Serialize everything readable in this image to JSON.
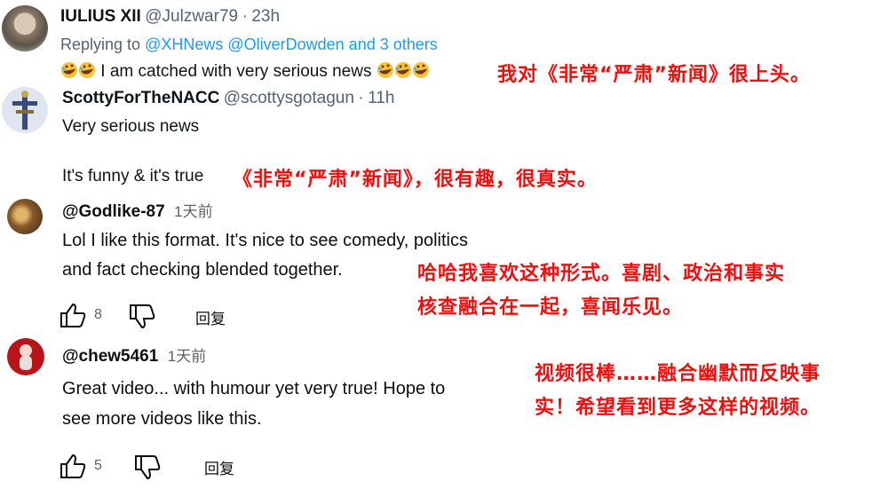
{
  "tweet1": {
    "name": "IULIUS XII",
    "handle": "@Julzwar79",
    "dot": "·",
    "time": "23h",
    "replying_prefix": "Replying to",
    "replying_mentions": "@XHNews @OliverDowden and 3 others",
    "text": "I am catched with very serious news",
    "emoji_icon": "rolling-on-floor-laughing-emoji",
    "translation": "我对《非常“严肃”新闻》很上头。"
  },
  "tweet2": {
    "name": "ScottyForTheNACC",
    "handle": "@scottysgotagun",
    "dot": "·",
    "time": "11h",
    "text_line1": "Very serious news",
    "text_line2": "It's funny & it's true",
    "translation": "《非常“严肃”新闻》，很有趣，很真实。"
  },
  "comment1": {
    "name": "@Godlike-87",
    "time": "1天前",
    "text_line1": "Lol I like this format. It's nice to see comedy, politics",
    "text_line2": "and fact checking blended together.",
    "likes": "8",
    "reply_label": "回复",
    "translation_line1": "哈哈我喜欢这种形式。喜剧、政治和事实",
    "translation_line2": "核查融合在一起，喜闻乐见。"
  },
  "comment2": {
    "name": "@chew5461",
    "time": "1天前",
    "text_line1": "Great video...  with humour yet very true!  Hope to",
    "text_line2": "see more videos like this.",
    "likes": "5",
    "reply_label": "回复",
    "translation_line1": "视频很棒……融合幽默而反映事",
    "translation_line2": "实！希望看到更多这样的视频。"
  },
  "colors": {
    "annotation_red": "#ee0f0f",
    "mention_blue": "#1d9bf0",
    "secondary_gray": "#536471"
  }
}
